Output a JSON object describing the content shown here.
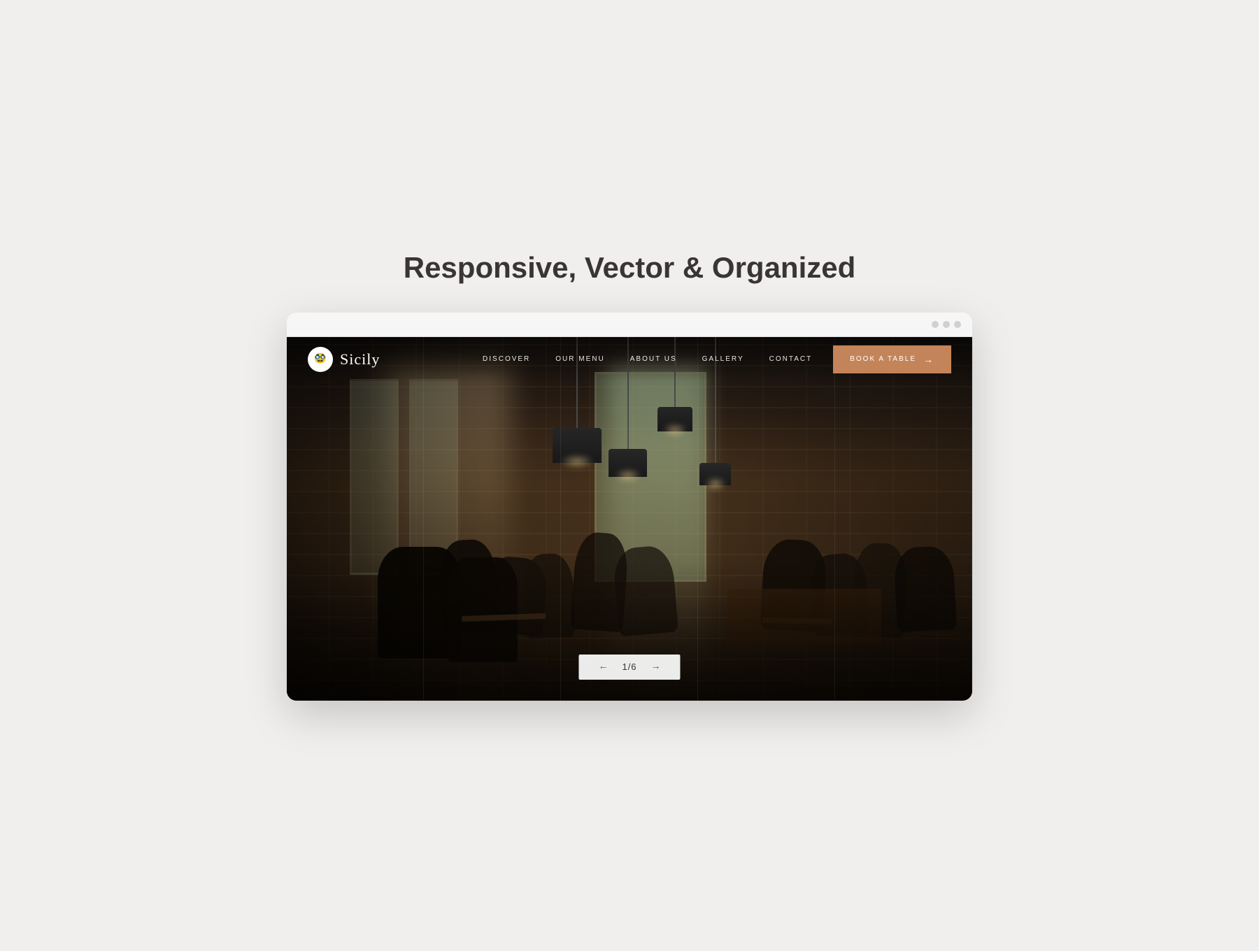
{
  "page": {
    "title": "Responsive, Vector & Organized"
  },
  "browser": {
    "dots": [
      "dot1",
      "dot2",
      "dot3"
    ]
  },
  "website": {
    "logo": {
      "icon": "🥸",
      "name": "Sicily"
    },
    "nav": {
      "links": [
        "DISCOVER",
        "OUR MENU",
        "ABOUT US",
        "GALLERY",
        "CONTACT"
      ],
      "cta_label": "BOOK A TABLE",
      "cta_arrow": "→"
    },
    "pagination": {
      "prev": "←",
      "current": "1/6",
      "next": "→"
    }
  },
  "colors": {
    "accent": "#c4845a",
    "background": "#f0efed",
    "text_dark": "#3a3535",
    "nav_bg": "rgba(0,0,0,0.4)",
    "white": "#ffffff"
  }
}
